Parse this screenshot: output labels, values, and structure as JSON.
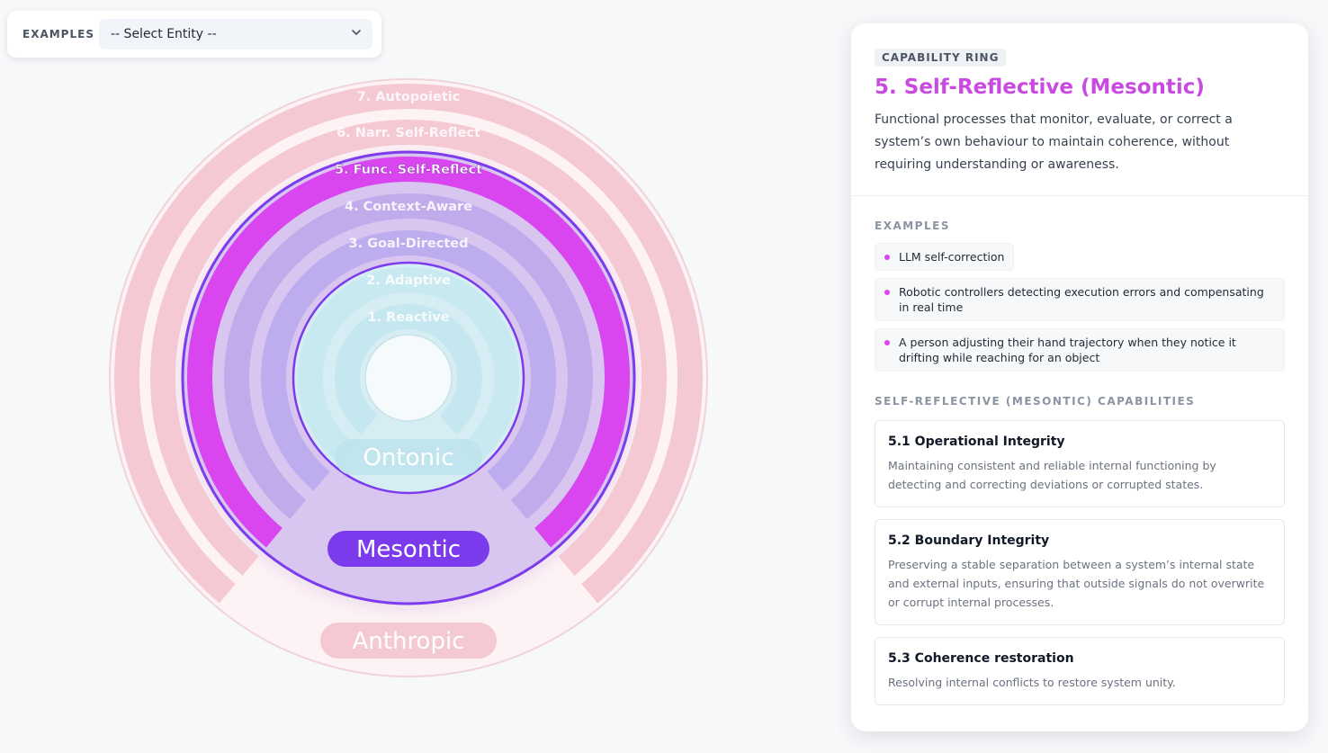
{
  "toolbar": {
    "examples_label": "EXAMPLES",
    "entity_select": {
      "selected": "-- Select Entity --",
      "icon": "chevron-down-icon"
    }
  },
  "diagram": {
    "rings": [
      {
        "label": "7. Autopoietic",
        "level": 7,
        "selected": false
      },
      {
        "label": "6. Narr. Self-Reflect",
        "level": 6,
        "selected": false
      },
      {
        "label": "5. Func. Self-Reflect",
        "level": 5,
        "selected": true
      },
      {
        "label": "4. Context-Aware",
        "level": 4,
        "selected": false
      },
      {
        "label": "3. Goal-Directed",
        "level": 3,
        "selected": false
      },
      {
        "label": "2. Adaptive",
        "level": 2,
        "selected": false
      },
      {
        "label": "1. Reactive",
        "level": 1,
        "selected": false
      }
    ],
    "zones": [
      {
        "label": "Ontonic",
        "active": false
      },
      {
        "label": "Mesontic",
        "active": true
      },
      {
        "label": "Anthropic",
        "active": false
      }
    ],
    "colors": {
      "anthropic": "#f4c9d4",
      "mesontic": "#c6b3ee",
      "ontonic": "#c9e9f0",
      "selected_ring": "#d946ef",
      "selected_outline": "#7c3aed"
    }
  },
  "panel": {
    "badge": "CAPABILITY RING",
    "title": "5. Self-Reflective (Mesontic)",
    "description": "Functional processes that monitor, evaluate, or correct a system’s own behaviour to maintain coherence, without requiring understanding or awareness.",
    "examples_title": "EXAMPLES",
    "examples": [
      "LLM self-correction",
      "Robotic controllers detecting execution errors and compensating in real time",
      "A person adjusting their hand trajectory when they notice it drifting while reaching for an object"
    ],
    "capabilities_title": "SELF-REFLECTIVE (MESONTIC) CAPABILITIES",
    "capabilities": [
      {
        "title": "5.1 Operational Integrity",
        "description": "Maintaining consistent and reliable internal functioning by detecting and correcting deviations or corrupted states."
      },
      {
        "title": "5.2 Boundary Integrity",
        "description": "Preserving a stable separation between a system’s internal state and external inputs, ensuring that outside signals do not overwrite or corrupt internal processes."
      },
      {
        "title": "5.3 Coherence restoration",
        "description": "Resolving internal conflicts to restore system unity."
      }
    ]
  }
}
